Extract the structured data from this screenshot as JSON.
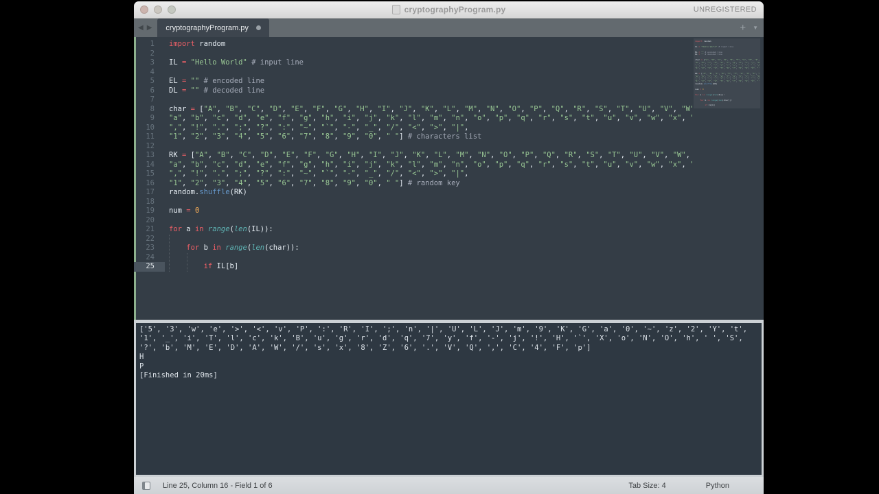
{
  "window": {
    "title": "cryptographyProgram.py",
    "registration": "UNREGISTERED"
  },
  "icons": {
    "back_arrow": "◀",
    "forward_arrow": "▶",
    "new_tab": "+",
    "tab_overflow": "▼"
  },
  "tabbar": {
    "active_tab": "cryptographyProgram.py",
    "modified": true
  },
  "colors": {
    "foreground": "#e6edf3",
    "keyword": "#ec5f66",
    "string": "#99c794",
    "comment": "#a6acb9",
    "number": "#f9ae58",
    "builtin": "#5fb4b4",
    "function": "#6699cc",
    "editor_bg": "#343d46",
    "console_bg": "#2e3842"
  },
  "editor": {
    "current_line": 25,
    "lines": [
      [
        [
          "k",
          "import"
        ],
        [
          "p",
          " random"
        ]
      ],
      [],
      [
        [
          "p",
          "IL "
        ],
        [
          "k",
          "="
        ],
        [
          "p",
          " "
        ],
        [
          "s",
          "\"Hello World\""
        ],
        [
          "p",
          " "
        ],
        [
          "c",
          "# input line"
        ]
      ],
      [],
      [
        [
          "p",
          "EL "
        ],
        [
          "k",
          "="
        ],
        [
          "p",
          " "
        ],
        [
          "s",
          "\"\""
        ],
        [
          "p",
          " "
        ],
        [
          "c",
          "# encoded line"
        ]
      ],
      [
        [
          "p",
          "DL "
        ],
        [
          "k",
          "="
        ],
        [
          "p",
          " "
        ],
        [
          "s",
          "\"\""
        ],
        [
          "p",
          " "
        ],
        [
          "c",
          "# decoded line"
        ]
      ],
      [],
      [
        [
          "l",
          "char = [\"A\", \"B\", \"C\", \"D\", \"E\", \"F\", \"G\", \"H\", \"I\", \"J\", \"K\", \"L\", \"M\", \"N\", \"O\", \"P\", \"Q\", \"R\", \"S\", \"T\", \"U\", \"V\", \"W\", \"X\", \"Y\", \"Z\","
        ]
      ],
      [
        [
          "l",
          "\"a\", \"b\", \"c\", \"d\", \"e\", \"f\", \"g\", \"h\", \"i\", \"j\", \"k\", \"l\", \"m\", \"n\", \"o\", \"p\", \"q\", \"r\", \"s\", \"t\", \"u\", \"v\", \"w\", \"x\", \"y\", \"z\","
        ]
      ],
      [
        [
          "l",
          "\",\", \"!\", \".\", \";\", \"?\", \":\", \"~\", \"`\", \"-\", \"_\", \"/\", \"<\", \">\", \"|\","
        ]
      ],
      [
        [
          "l",
          "\"1\", \"2\", \"3\", \"4\", \"5\", \"6\", \"7\", \"8\", \"9\", \"0\", \" \"] # characters list"
        ]
      ],
      [],
      [
        [
          "l",
          "RK = [\"A\", \"B\", \"C\", \"D\", \"E\", \"F\", \"G\", \"H\", \"I\", \"J\", \"K\", \"L\", \"M\", \"N\", \"O\", \"P\", \"Q\", \"R\", \"S\", \"T\", \"U\", \"V\", \"W\", \"X\", \"Y\", \"Z\","
        ]
      ],
      [
        [
          "l",
          "\"a\", \"b\", \"c\", \"d\", \"e\", \"f\", \"g\", \"h\", \"i\", \"j\", \"k\", \"l\", \"m\", \"n\", \"o\", \"p\", \"q\", \"r\", \"s\", \"t\", \"u\", \"v\", \"w\", \"x\", \"y\", \"z\","
        ]
      ],
      [
        [
          "l",
          "\",\", \"!\", \".\", \";\", \"?\", \":\", \"~\", \"`\", \"-\", \"_\", \"/\", \"<\", \">\", \"|\","
        ]
      ],
      [
        [
          "l",
          "\"1\", \"2\", \"3\", \"4\", \"5\", \"6\", \"7\", \"8\", \"9\", \"0\", \" \"] # random key"
        ]
      ],
      [
        [
          "p",
          "random."
        ],
        [
          "b",
          "shuffle"
        ],
        [
          "p",
          "(RK)"
        ]
      ],
      [],
      [
        [
          "p",
          "num "
        ],
        [
          "k",
          "="
        ],
        [
          "p",
          " "
        ],
        [
          "n",
          "0"
        ]
      ],
      [],
      [
        [
          "k",
          "for"
        ],
        [
          "p",
          " a "
        ],
        [
          "k",
          "in"
        ],
        [
          "p",
          " "
        ],
        [
          "f",
          "range"
        ],
        [
          "p",
          "("
        ],
        [
          "f",
          "len"
        ],
        [
          "p",
          "(IL)):"
        ]
      ],
      [],
      [
        [
          "p",
          "    "
        ],
        [
          "k",
          "for"
        ],
        [
          "p",
          " b "
        ],
        [
          "k",
          "in"
        ],
        [
          "p",
          " "
        ],
        [
          "f",
          "range"
        ],
        [
          "p",
          "("
        ],
        [
          "f",
          "len"
        ],
        [
          "p",
          "(char)):"
        ]
      ],
      [],
      [
        [
          "p",
          "        "
        ],
        [
          "k",
          "if"
        ],
        [
          "p",
          " IL[b]"
        ]
      ]
    ]
  },
  "console": {
    "lines": [
      "['5', '3', 'w', 'e', '>', '<', 'v', 'P', ':', 'R', 'I', ';', 'n', '|', 'U', 'L', 'J', 'm', '9', 'K', 'G', 'a', '0', '~', 'z', '2', 'Y', 't',",
      "'1', '_', 'i', 'T', 'l', 'c', 'k', 'B', 'u', 'g', 'r', 'd', 'q', '7', 'y', 'f', '-', 'j', '!', 'H', '`', 'X', 'o', 'N', 'O', 'h', ' ', 'S',",
      "'?', 'b', 'M', 'E', 'D', 'A', 'W', '/', 's', 'x', '8', 'Z', '6', '.', 'V', 'Q', ',', 'C', '4', 'F', 'p']",
      "H",
      "P",
      "[Finished in 20ms]"
    ]
  },
  "statusbar": {
    "position": "Line 25, Column 16 - Field 1 of 6",
    "tab_size": "Tab Size: 4",
    "syntax": "Python"
  }
}
